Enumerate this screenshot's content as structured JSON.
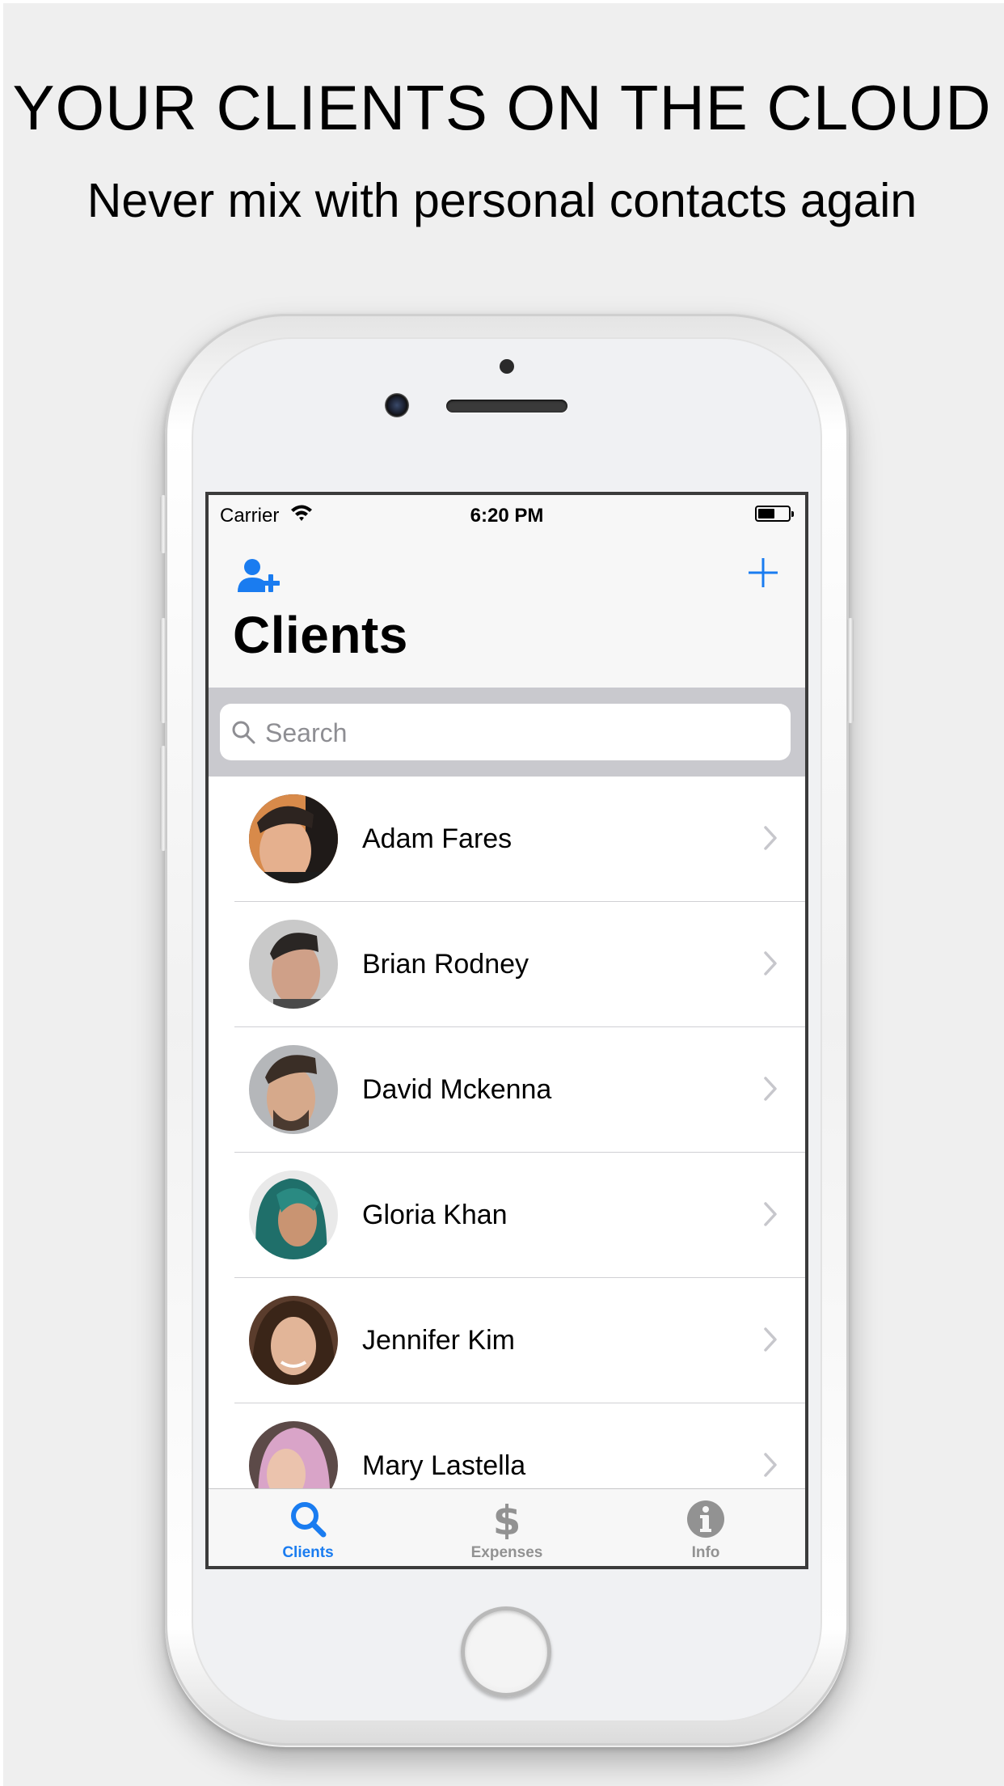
{
  "promo": {
    "headline": "YOUR CLIENTS ON THE CLOUD",
    "subheadline": "Never mix with personal contacts again"
  },
  "status_bar": {
    "carrier": "Carrier",
    "time": "6:20 PM"
  },
  "nav": {
    "title": "Clients",
    "left_icon": "add-person-icon",
    "right_icon": "plus-icon"
  },
  "search": {
    "placeholder": "Search"
  },
  "clients": [
    {
      "name": "Adam Fares"
    },
    {
      "name": "Brian Rodney"
    },
    {
      "name": "David Mckenna"
    },
    {
      "name": "Gloria Khan"
    },
    {
      "name": "Jennifer Kim"
    },
    {
      "name": "Mary Lastella"
    }
  ],
  "tabs": [
    {
      "label": "Clients",
      "icon": "search-icon",
      "active": true
    },
    {
      "label": "Expenses",
      "icon": "dollar-icon",
      "active": false
    },
    {
      "label": "Info",
      "icon": "info-icon",
      "active": false
    }
  ],
  "colors": {
    "accent": "#1a7cf0",
    "inactive": "#929292",
    "background": "#efefef"
  }
}
